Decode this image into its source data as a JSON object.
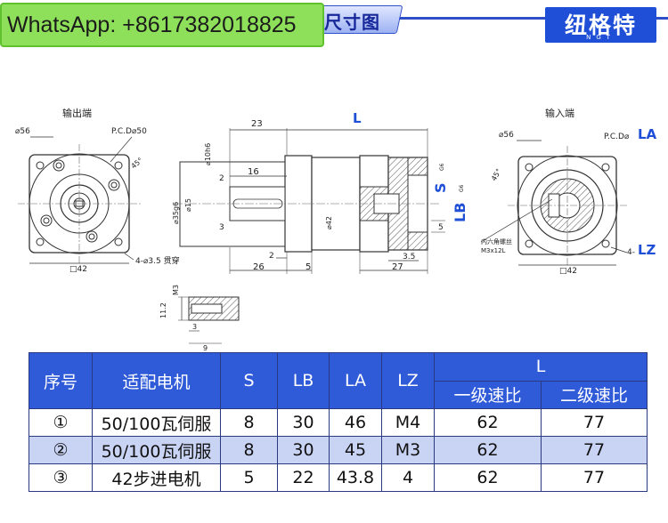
{
  "overlay": {
    "whatsapp": "WhatsApp: +8617382018825"
  },
  "header": {
    "title": "尺寸图",
    "brand_cn": "纽格特",
    "brand_en": "NGT"
  },
  "drawing": {
    "output_label": "输出端",
    "input_label": "输入端",
    "out_dia": "⌀56",
    "out_pcd": "P.C.D⌀50",
    "out_angle": "45°",
    "out_hole": "4-⌀3.5 贯穿",
    "out_square": "□42",
    "dim_23": "23",
    "dim_L": "L",
    "dim_10h6": "⌀10h6",
    "dim_35g6": "⌀35g6",
    "dim_15": "⌀15",
    "dim_16": "16",
    "dim_2a": "2",
    "dim_3a": "3",
    "dim_42": "⌀42",
    "dim_S": "S",
    "dim_S_tol": "G6",
    "dim_LB": "LB",
    "dim_LB_tol": "G6",
    "dim_5a": "5",
    "dim_2b": "2",
    "dim_26": "26",
    "dim_5b": "5",
    "dim_3_5": "3.5",
    "dim_27": "27",
    "in_dia": "⌀56",
    "in_pcd": "P.C.D⌀",
    "in_pcd_var": "LA",
    "in_angle": "45°",
    "in_screw_1": "内六角螺丝",
    "in_screw_2": "M3x12L",
    "in_hole_prefix": "4-",
    "in_hole_var": "LZ",
    "in_square": "□42",
    "key_m3": "M3",
    "key_11_2": "11.2",
    "key_3": "3",
    "key_9": "9"
  },
  "table": {
    "headers": {
      "no": "序号",
      "motor": "适配电机",
      "s": "S",
      "lb": "LB",
      "la": "LA",
      "lz": "LZ",
      "l": "L",
      "stage1": "一级速比",
      "stage2": "二级速比"
    },
    "rows": [
      {
        "no": "①",
        "motor": "50/100瓦伺服",
        "s": "8",
        "lb": "30",
        "la": "46",
        "lz": "M4",
        "l1": "62",
        "l2": "77"
      },
      {
        "no": "②",
        "motor": "50/100瓦伺服",
        "s": "8",
        "lb": "30",
        "la": "45",
        "lz": "M3",
        "l1": "62",
        "l2": "77"
      },
      {
        "no": "③",
        "motor": "42步进电机",
        "s": "5",
        "lb": "22",
        "la": "43.8",
        "lz": "4",
        "l1": "62",
        "l2": "77"
      }
    ]
  }
}
